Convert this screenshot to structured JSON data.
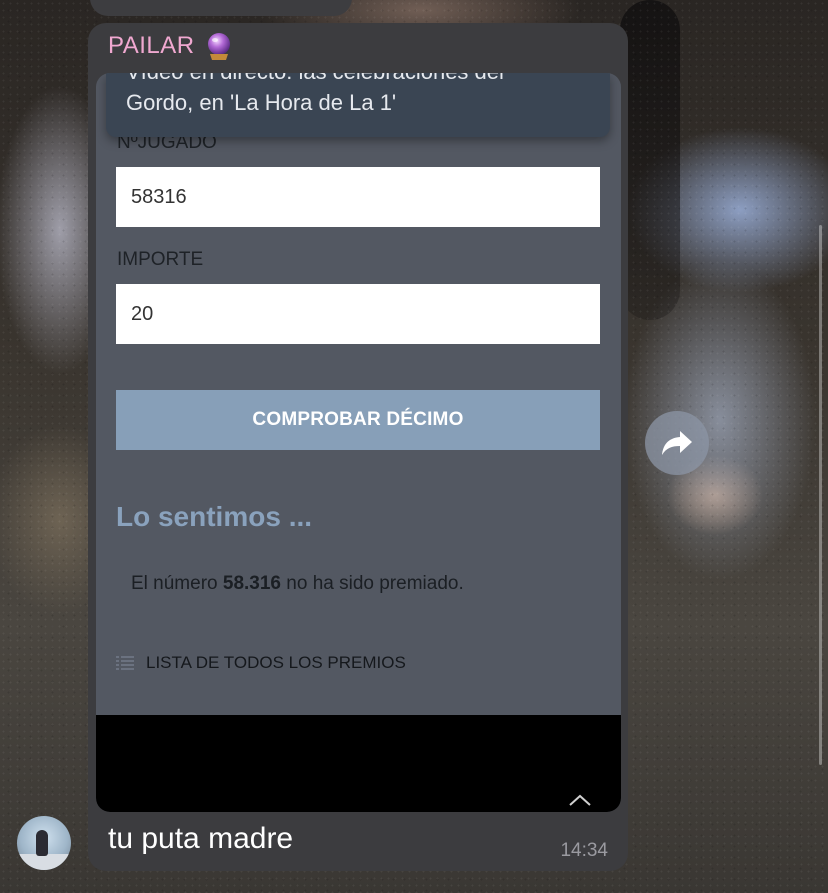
{
  "chat": {
    "message": {
      "sender": "PAILAR",
      "sender_color": "#f0a8d0",
      "sender_emoji_icon": "crystal-ball-icon",
      "text": "tu puta madre",
      "time": "14:34"
    }
  },
  "screenshot": {
    "notification": {
      "line1": "Vídeo en directo: las celebraciones del",
      "line2": "Gordo, en 'La Hora de La 1'"
    },
    "form": {
      "number_label": "NºJUGADO",
      "number_value": "58316",
      "amount_label": "IMPORTE",
      "amount_value": "20",
      "button_label": "COMPROBAR DÉCIMO",
      "button_color": "#879fb8"
    },
    "result": {
      "heading": "Lo sentimos ...",
      "text_before": "El número ",
      "number": "58.316",
      "text_after": " no ha sido premiado."
    },
    "prizes_link": "LISTA DE TODOS LOS PREMIOS"
  }
}
